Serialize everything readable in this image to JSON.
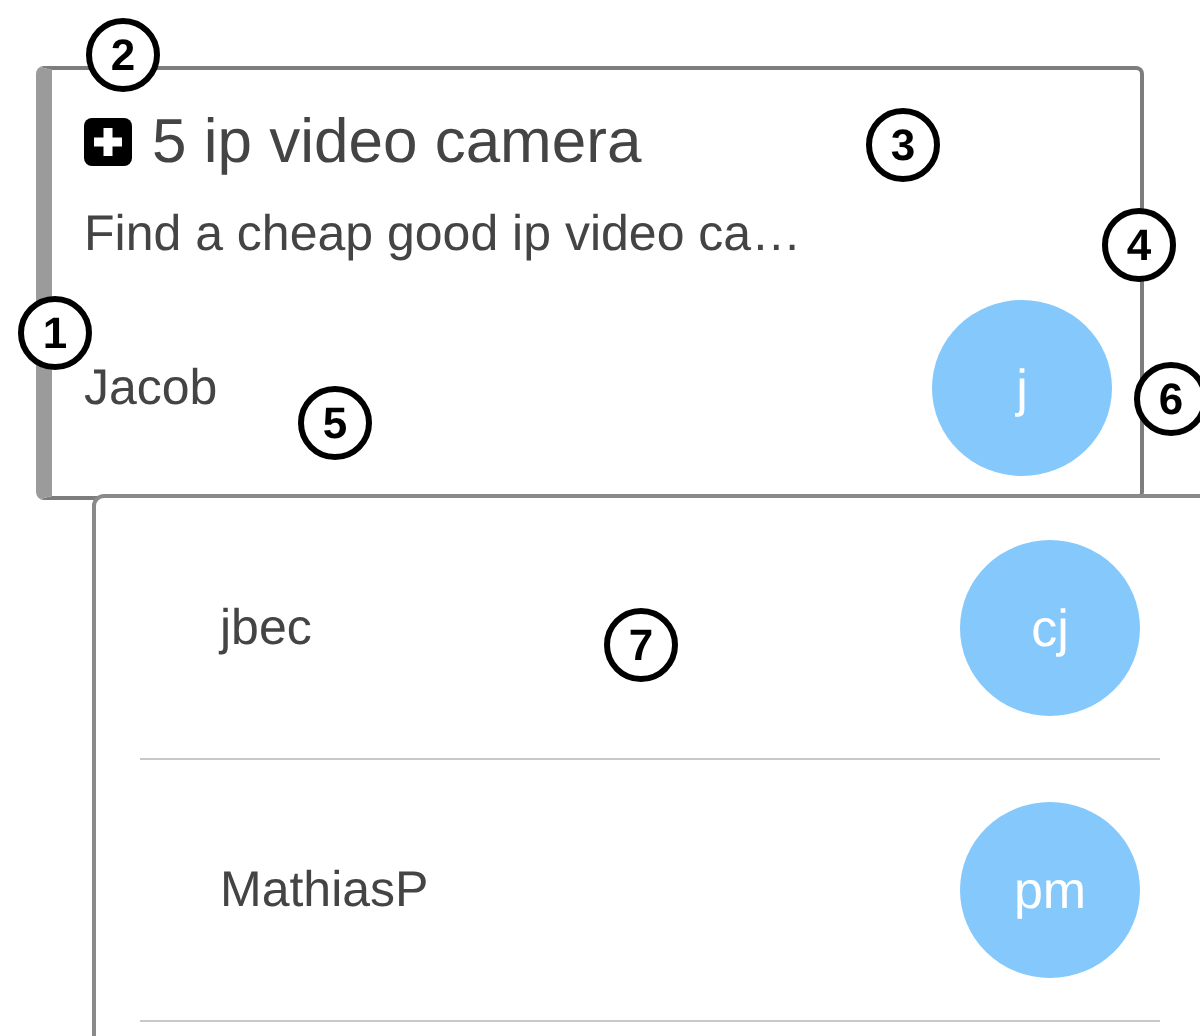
{
  "card": {
    "title": "5 ip video camera",
    "description": "Find a cheap good ip video ca…",
    "owner": "Jacob",
    "owner_avatar": "j"
  },
  "user_list": [
    {
      "name": "jbec",
      "avatar": "cj"
    },
    {
      "name": "MathiasP",
      "avatar": "pm"
    }
  ],
  "callouts": [
    "1",
    "2",
    "3",
    "4",
    "5",
    "6",
    "7"
  ]
}
